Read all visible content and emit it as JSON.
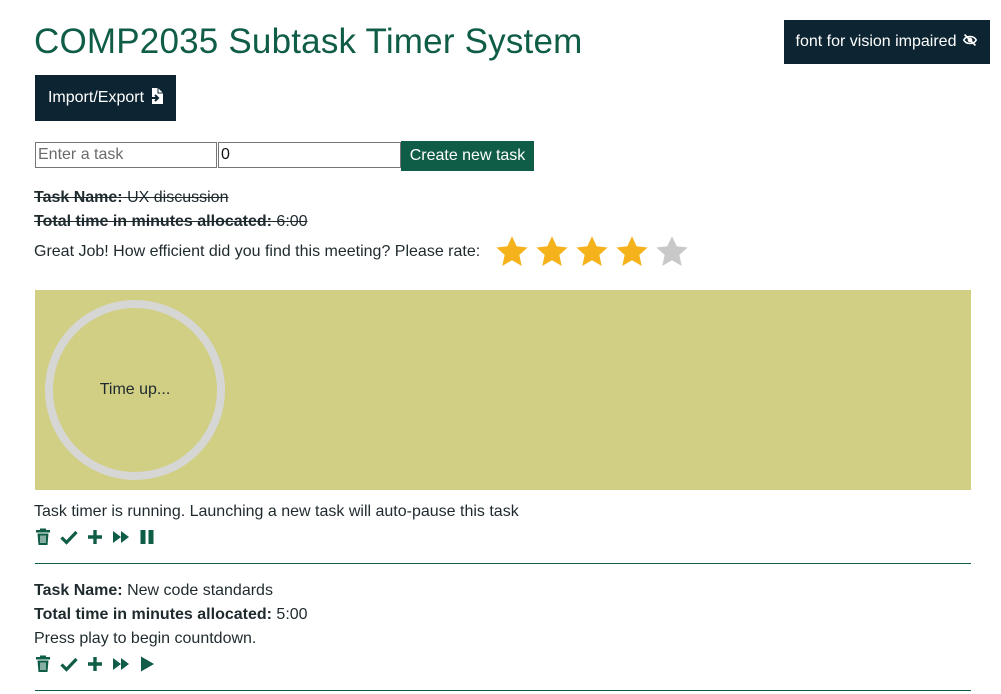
{
  "header": {
    "title": "COMP2035 Subtask Timer System",
    "vision_button_label": "font for vision impaired",
    "vision_icon": "eye-slash-icon",
    "import_button_label": "Import/Export",
    "import_icon": "file-import-icon"
  },
  "new_task_form": {
    "task_placeholder": "Enter a task",
    "task_value": "",
    "minutes_value": "0",
    "create_label": "Create new task"
  },
  "tasks": [
    {
      "name_label": "Task Name:",
      "name": "UX discussion",
      "time_label": "Total time in minutes allocated:",
      "time": "6:00",
      "completed": true,
      "rating_prompt": "Great Job! How efficient did you find this meeting? Please rate:",
      "rating": 4,
      "rating_max": 5,
      "timer_text": "Time up...",
      "status": "Task timer is running. Launching a new task will auto-pause this task",
      "controls": [
        "trash-icon",
        "check-icon",
        "plus-icon",
        "fast-forward-icon",
        "pause-icon"
      ]
    },
    {
      "name_label": "Task Name:",
      "name": "New code standards",
      "time_label": "Total time in minutes allocated:",
      "time": "5:00",
      "completed": false,
      "status": "Press play to begin countdown.",
      "controls": [
        "trash-icon",
        "check-icon",
        "plus-icon",
        "fast-forward-icon",
        "play-icon"
      ]
    }
  ],
  "colors": {
    "heading": "#0f5c47",
    "dark_button": "#0d2532",
    "accent_button": "#0f5c47",
    "timer_panel": "#d0cf84",
    "timer_ring": "#d6d6d4",
    "star_filled": "#f6b21c",
    "star_empty": "#c8c8c8"
  }
}
